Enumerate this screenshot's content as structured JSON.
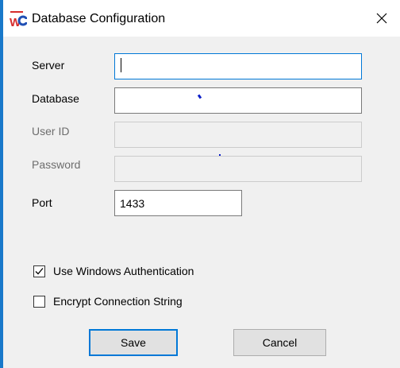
{
  "window": {
    "title": "Database Configuration",
    "app_icon": "wc-logo-icon",
    "close_icon": "close-icon",
    "accent_color": "#1979ca"
  },
  "form": {
    "server": {
      "label": "Server",
      "value": ""
    },
    "database": {
      "label": "Database",
      "value": ""
    },
    "user_id": {
      "label": "User ID",
      "value": ""
    },
    "password": {
      "label": "Password",
      "value": ""
    },
    "port": {
      "label": "Port",
      "value": "1433"
    }
  },
  "options": {
    "windows_auth": {
      "label": "Use Windows Authentication",
      "checked": true
    },
    "encrypt": {
      "label": "Encrypt Connection String",
      "checked": false
    }
  },
  "buttons": {
    "save_label": "Save",
    "cancel_label": "Cancel"
  }
}
